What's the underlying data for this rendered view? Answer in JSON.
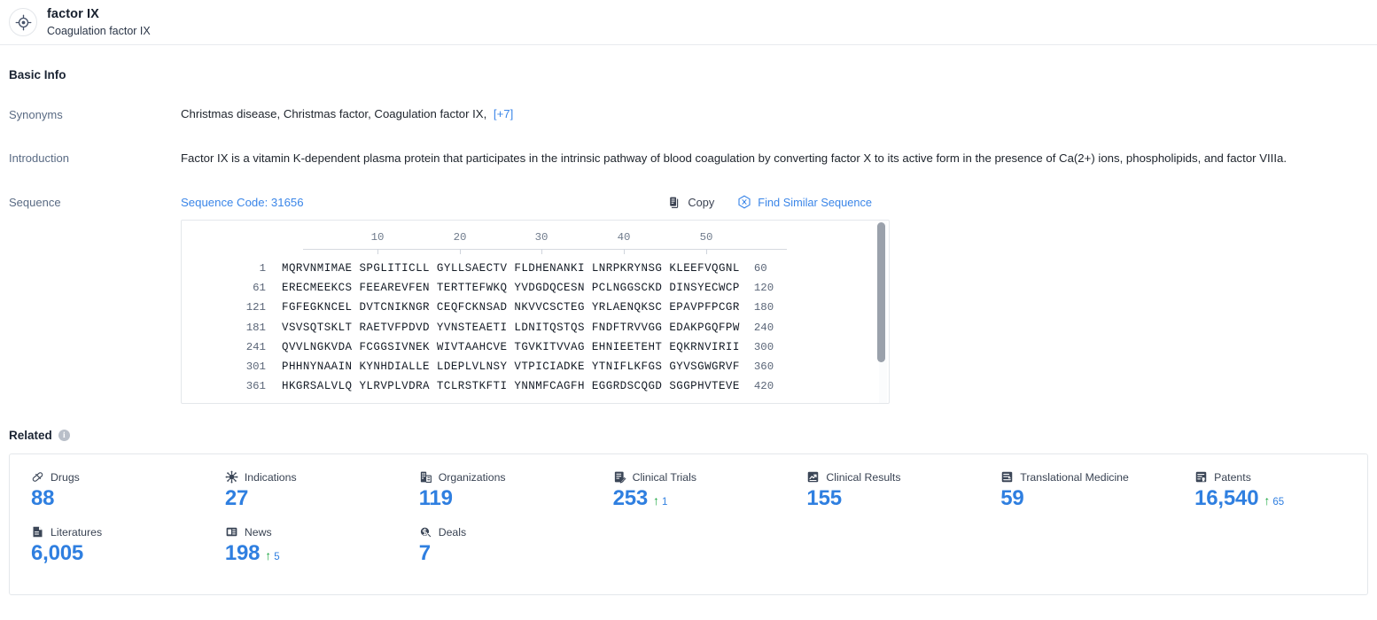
{
  "header": {
    "icon": "target-crosshair-icon",
    "title": "factor IX",
    "subtitle": "Coagulation factor IX"
  },
  "basic_info": {
    "section_title": "Basic Info",
    "synonyms": {
      "label": "Synonyms",
      "items": [
        "Christmas disease,",
        "Christmas factor,",
        "Coagulation factor IX,"
      ],
      "more": "[+7]"
    },
    "introduction": {
      "label": "Introduction",
      "text": "Factor IX is a vitamin K-dependent plasma protein that participates in the intrinsic pathway of blood coagulation by converting factor X to its active form in the presence of Ca(2+) ions, phospholipids, and factor VIIIa."
    },
    "sequence": {
      "label": "Sequence",
      "code_label": "Sequence Code: 31656",
      "copy_label": "Copy",
      "find_similar_label": "Find Similar Sequence",
      "ruler_ticks": [
        10,
        20,
        30,
        40,
        50
      ],
      "rows": [
        {
          "start": "1",
          "blocks": [
            "MQRVNMIMAE",
            "SPGLITICLL",
            "GYLLSAECTV",
            "FLDHENANKI",
            "LNRPKRYNSG",
            "KLEEFVQGNL"
          ],
          "end": "60"
        },
        {
          "start": "61",
          "blocks": [
            "ERECMEEKCS",
            "FEEAREVFEN",
            "TERTTEFWKQ",
            "YVDGDQCESN",
            "PCLNGGSCKD",
            "DINSYECWCP"
          ],
          "end": "120"
        },
        {
          "start": "121",
          "blocks": [
            "FGFEGKNCEL",
            "DVTCNIKNGR",
            "CEQFCKNSAD",
            "NKVVCSCTEG",
            "YRLAENQKSC",
            "EPAVPFPCGR"
          ],
          "end": "180"
        },
        {
          "start": "181",
          "blocks": [
            "VSVSQTSKLT",
            "RAETVFPDVD",
            "YVNSTEAETI",
            "LDNITQSTQS",
            "FNDFTRVVGG",
            "EDAKPGQFPW"
          ],
          "end": "240"
        },
        {
          "start": "241",
          "blocks": [
            "QVVLNGKVDA",
            "FCGGSIVNEK",
            "WIVTAAHCVE",
            "TGVKITVVAG",
            "EHNIEETEHT",
            "EQKRNVIRII"
          ],
          "end": "300"
        },
        {
          "start": "301",
          "blocks": [
            "PHHNYNAAIN",
            "KYNHDIALLE",
            "LDEPLVLNSY",
            "VTPICIADKE",
            "YTNIFLKFGS",
            "GYVSGWGRVF"
          ],
          "end": "360"
        },
        {
          "start": "361",
          "blocks": [
            "HKGRSALVLQ",
            "YLRVPLVDRA",
            "TCLRSTKFTI",
            "YNNMFCAGFH",
            "EGGRDSCQGD",
            "SGGPHVTEVE"
          ],
          "end": "420"
        }
      ]
    }
  },
  "related": {
    "title": "Related",
    "info_glyph": "i",
    "stats": [
      {
        "icon": "pill-icon",
        "label": "Drugs",
        "value": "88"
      },
      {
        "icon": "virus-icon",
        "label": "Indications",
        "value": "27"
      },
      {
        "icon": "building-icon",
        "label": "Organizations",
        "value": "119"
      },
      {
        "icon": "clinical-trial-icon",
        "label": "Clinical Trials",
        "value": "253",
        "delta": "1"
      },
      {
        "icon": "clinical-result-icon",
        "label": "Clinical Results",
        "value": "155"
      },
      {
        "icon": "translational-medicine-icon",
        "label": "Translational Medicine",
        "value": "59"
      },
      {
        "icon": "patent-icon",
        "label": "Patents",
        "value": "16,540",
        "delta": "65"
      },
      {
        "icon": "literature-icon",
        "label": "Literatures",
        "value": "6,005"
      },
      {
        "icon": "news-icon",
        "label": "News",
        "value": "198",
        "delta": "5"
      },
      {
        "icon": "deal-icon",
        "label": "Deals",
        "value": "7"
      }
    ]
  },
  "colors": {
    "accent_blue": "#2f7fe0",
    "link_blue": "#3b86e8",
    "delta_green": "#1aa640",
    "icon_navy": "#3b4657",
    "border": "#e4e7eb"
  }
}
